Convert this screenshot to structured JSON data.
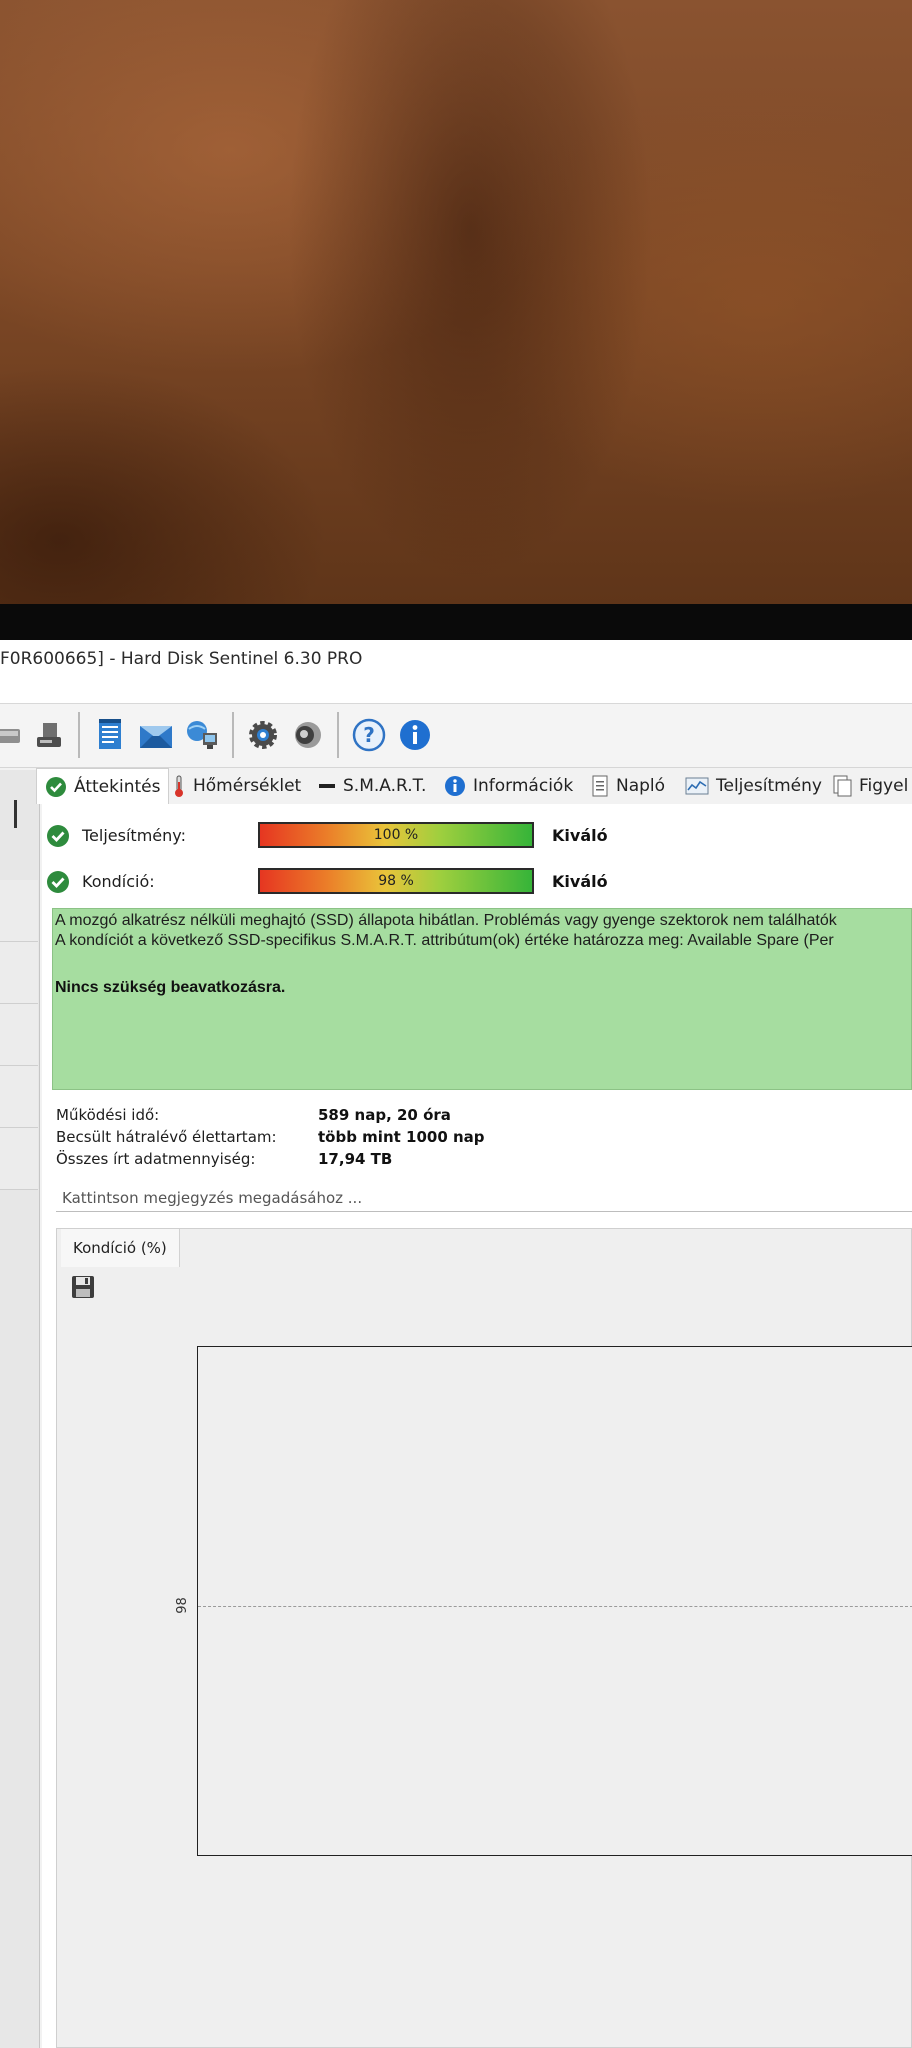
{
  "window": {
    "title": "F0R600665]  -  Hard Disk Sentinel 6.30 PRO"
  },
  "toolbar": {
    "buttons": [
      "disk-icon",
      "disk-report-icon",
      "report-icon",
      "email-icon",
      "network-icon",
      "settings-icon",
      "sound-icon",
      "help-icon",
      "info-icon"
    ]
  },
  "tabs": [
    {
      "label": "Áttekintés",
      "icon": "check-icon"
    },
    {
      "label": "Hőmérséklet",
      "icon": "thermometer-icon"
    },
    {
      "label": "S.M.A.R.T.",
      "icon": "dash-icon"
    },
    {
      "label": "Információk",
      "icon": "info-icon"
    },
    {
      "label": "Napló",
      "icon": "log-icon"
    },
    {
      "label": "Teljesítmény",
      "icon": "chart-icon"
    },
    {
      "label": "Figyel",
      "icon": "alert-icon"
    }
  ],
  "health": {
    "performance": {
      "label": "Teljesítmény:",
      "value_text": "100 %",
      "value": 100,
      "rating": "Kiváló"
    },
    "condition": {
      "label": "Kondíció:",
      "value_text": "98 %",
      "value": 98,
      "rating": "Kiváló"
    }
  },
  "status": {
    "line1": "A mozgó alkatrész nélküli meghajtó (SSD) állapota hibátlan. Problémás vagy gyenge szektorok nem találhatók",
    "line2": "A kondíciót a következő SSD-specifikus S.M.A.R.T. attribútum(ok) értéke határozza meg:  Available Spare (Per",
    "action": "Nincs szükség beavatkozásra.",
    "color": "#a6dda0"
  },
  "info": [
    {
      "label": "Működési idő:",
      "value": "589 nap, 20 óra"
    },
    {
      "label": "Becsült hátralévő élettartam:",
      "value": "több mint 1000 nap"
    },
    {
      "label": "Összes írt adatmennyiség:",
      "value": "17,94 TB"
    }
  ],
  "note": {
    "placeholder": "Kattintson megjegyzés megadásához ..."
  },
  "chart": {
    "tab_label": "Kondíció  (%)",
    "save_icon": "save-icon",
    "chart_data": {
      "type": "line",
      "title": "",
      "ylabel": "",
      "y_tick_labels": [
        "98"
      ],
      "series": [
        {
          "values": [
            98
          ]
        }
      ],
      "grid": true
    }
  }
}
